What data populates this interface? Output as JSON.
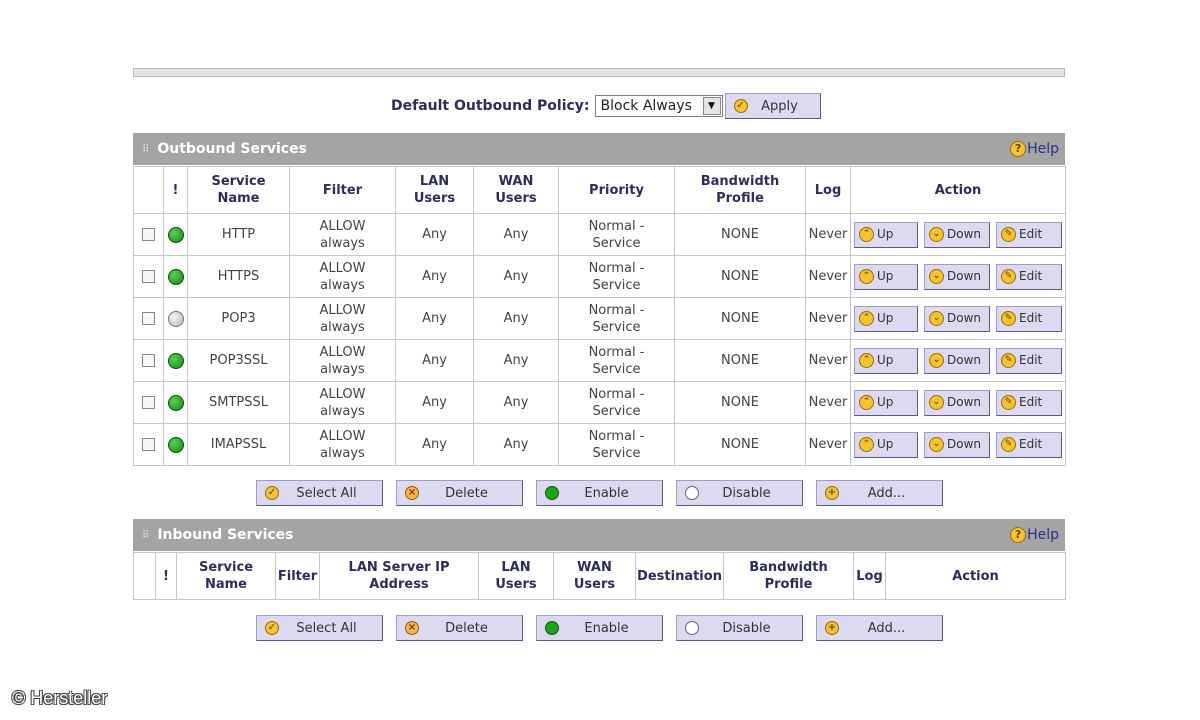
{
  "policy": {
    "label": "Default Outbound Policy:",
    "selected": "Block Always",
    "apply_label": "Apply"
  },
  "outbound": {
    "title": "Outbound Services",
    "help_label": "Help",
    "columns": {
      "status": "!",
      "service_name": [
        "Service",
        "Name"
      ],
      "filter": "Filter",
      "lan_users": [
        "LAN",
        "Users"
      ],
      "wan_users": [
        "WAN",
        "Users"
      ],
      "priority": "Priority",
      "bandwidth_profile": [
        "Bandwidth",
        "Profile"
      ],
      "log": "Log",
      "action": "Action"
    },
    "rows": [
      {
        "enabled": true,
        "service": "HTTP",
        "filter": [
          "ALLOW",
          "always"
        ],
        "lan": "Any",
        "wan": "Any",
        "priority": [
          "Normal -",
          "Service"
        ],
        "bandwidth": "NONE",
        "log": "Never"
      },
      {
        "enabled": true,
        "service": "HTTPS",
        "filter": [
          "ALLOW",
          "always"
        ],
        "lan": "Any",
        "wan": "Any",
        "priority": [
          "Normal -",
          "Service"
        ],
        "bandwidth": "NONE",
        "log": "Never"
      },
      {
        "enabled": false,
        "service": "POP3",
        "filter": [
          "ALLOW",
          "always"
        ],
        "lan": "Any",
        "wan": "Any",
        "priority": [
          "Normal -",
          "Service"
        ],
        "bandwidth": "NONE",
        "log": "Never"
      },
      {
        "enabled": true,
        "service": "POP3SSL",
        "filter": [
          "ALLOW",
          "always"
        ],
        "lan": "Any",
        "wan": "Any",
        "priority": [
          "Normal -",
          "Service"
        ],
        "bandwidth": "NONE",
        "log": "Never"
      },
      {
        "enabled": true,
        "service": "SMTPSSL",
        "filter": [
          "ALLOW",
          "always"
        ],
        "lan": "Any",
        "wan": "Any",
        "priority": [
          "Normal -",
          "Service"
        ],
        "bandwidth": "NONE",
        "log": "Never"
      },
      {
        "enabled": true,
        "service": "IMAPSSL",
        "filter": [
          "ALLOW",
          "always"
        ],
        "lan": "Any",
        "wan": "Any",
        "priority": [
          "Normal -",
          "Service"
        ],
        "bandwidth": "NONE",
        "log": "Never"
      }
    ],
    "row_actions": {
      "up": "Up",
      "down": "Down",
      "edit": "Edit"
    }
  },
  "bulk_actions": {
    "select_all": "Select All",
    "delete": "Delete",
    "enable": "Enable",
    "disable": "Disable",
    "add": "Add..."
  },
  "inbound": {
    "title": "Inbound Services",
    "help_label": "Help",
    "columns": {
      "status": "!",
      "service_name": [
        "Service",
        "Name"
      ],
      "filter": "Filter",
      "lan_server_ip": [
        "LAN Server IP",
        "Address"
      ],
      "lan_users": [
        "LAN",
        "Users"
      ],
      "wan_users": [
        "WAN",
        "Users"
      ],
      "destination": "Destination",
      "bandwidth_profile": [
        "Bandwidth",
        "Profile"
      ],
      "log": "Log",
      "action": "Action"
    }
  },
  "watermark": "© Hersteller",
  "colors": {
    "header_bar": "#a4a4a4",
    "button_face": "#ddd9f0",
    "label_text": "#2e2e5c",
    "status_on": "#22a022",
    "status_off": "#bbbbbb"
  }
}
